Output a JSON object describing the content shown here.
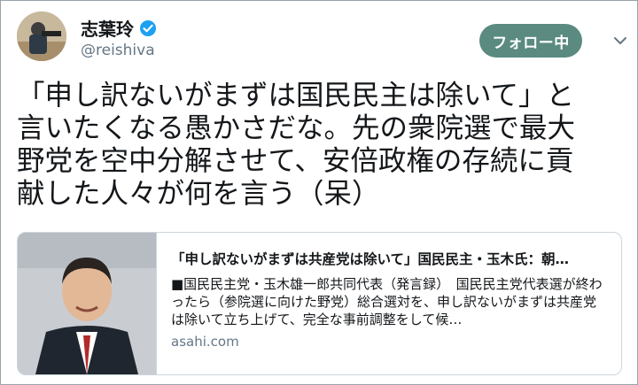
{
  "user": {
    "display_name": "志葉玲",
    "handle": "@reishiva",
    "verified": true
  },
  "follow_button": {
    "label": "フォロー中"
  },
  "tweet": {
    "text": "「申し訳ないがまずは国民民主は除いて」と\n言いたくなる愚かさだな。先の衆院選で最大\n野党を空中分解させて、安倍政権の存続に貢\n献した人々が何を言う（呆）"
  },
  "card": {
    "title": "「申し訳ないがまずは共産党は除いて」国民民主・玉木氏：朝…",
    "description": "■国民民主党・玉木雄一郎共同代表（発言録）　国民民主党代表選が終わったら（参院選に向けた野党）総合選対を、申し訳ないがまずは共産党は除いて立ち上げて、完全な事前調整をして候…",
    "domain": "asahi.com"
  },
  "colors": {
    "follow_bg": "#5a8a80",
    "verified": "#1da1f2",
    "handle": "#657786"
  },
  "icons": [
    "verified-badge-icon",
    "chevron-down-icon"
  ]
}
